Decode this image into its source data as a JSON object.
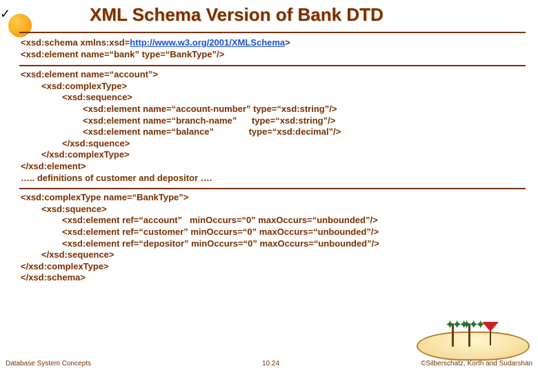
{
  "title": "XML Schema Version of Bank DTD",
  "block1": {
    "l1a": "<xsd:schema xmlns:xsd=",
    "l1link": "http://www.w3.org/2001/XMLSchema",
    "l1b": ">",
    "l2": "<xsd:element name=“bank” type=“BankType”/>"
  },
  "block2": {
    "l1": "<xsd:element name=“account”>",
    "l2": "<xsd:complexType>",
    "l3": "<xsd:sequence>",
    "l4": "<xsd:element name=“account-number” type=“xsd:string”/>",
    "l5": "<xsd:element name=“branch-name”      type=“xsd:string”/>",
    "l6": "<xsd:element name=“balance”              type=“xsd:decimal”/>",
    "l7": "</xsd:squence>",
    "l8": "</xsd:complexType>",
    "l9": "</xsd:element>",
    "l10": "….. definitions of customer and depositor …."
  },
  "block3": {
    "l1": "<xsd:complexType name=“BankType”>",
    "l2": "<xsd:squence>",
    "l3": "<xsd:element ref=“account”   minOccurs=“0” maxOccurs=“unbounded”/>",
    "l4": "<xsd:element ref=“customer” minOccurs=“0” maxOccurs=“unbounded”/>",
    "l5": "<xsd:element ref=“depositor” minOccurs=“0” maxOccurs=“unbounded”/>",
    "l6": "</xsd:sequence>",
    "l7": "</xsd:complexType>",
    "l8": "</xsd:schema>"
  },
  "footer": {
    "left": "Database System Concepts",
    "mid": "10.24",
    "right": "©Silberschatz, Korth and Sudarshan"
  }
}
